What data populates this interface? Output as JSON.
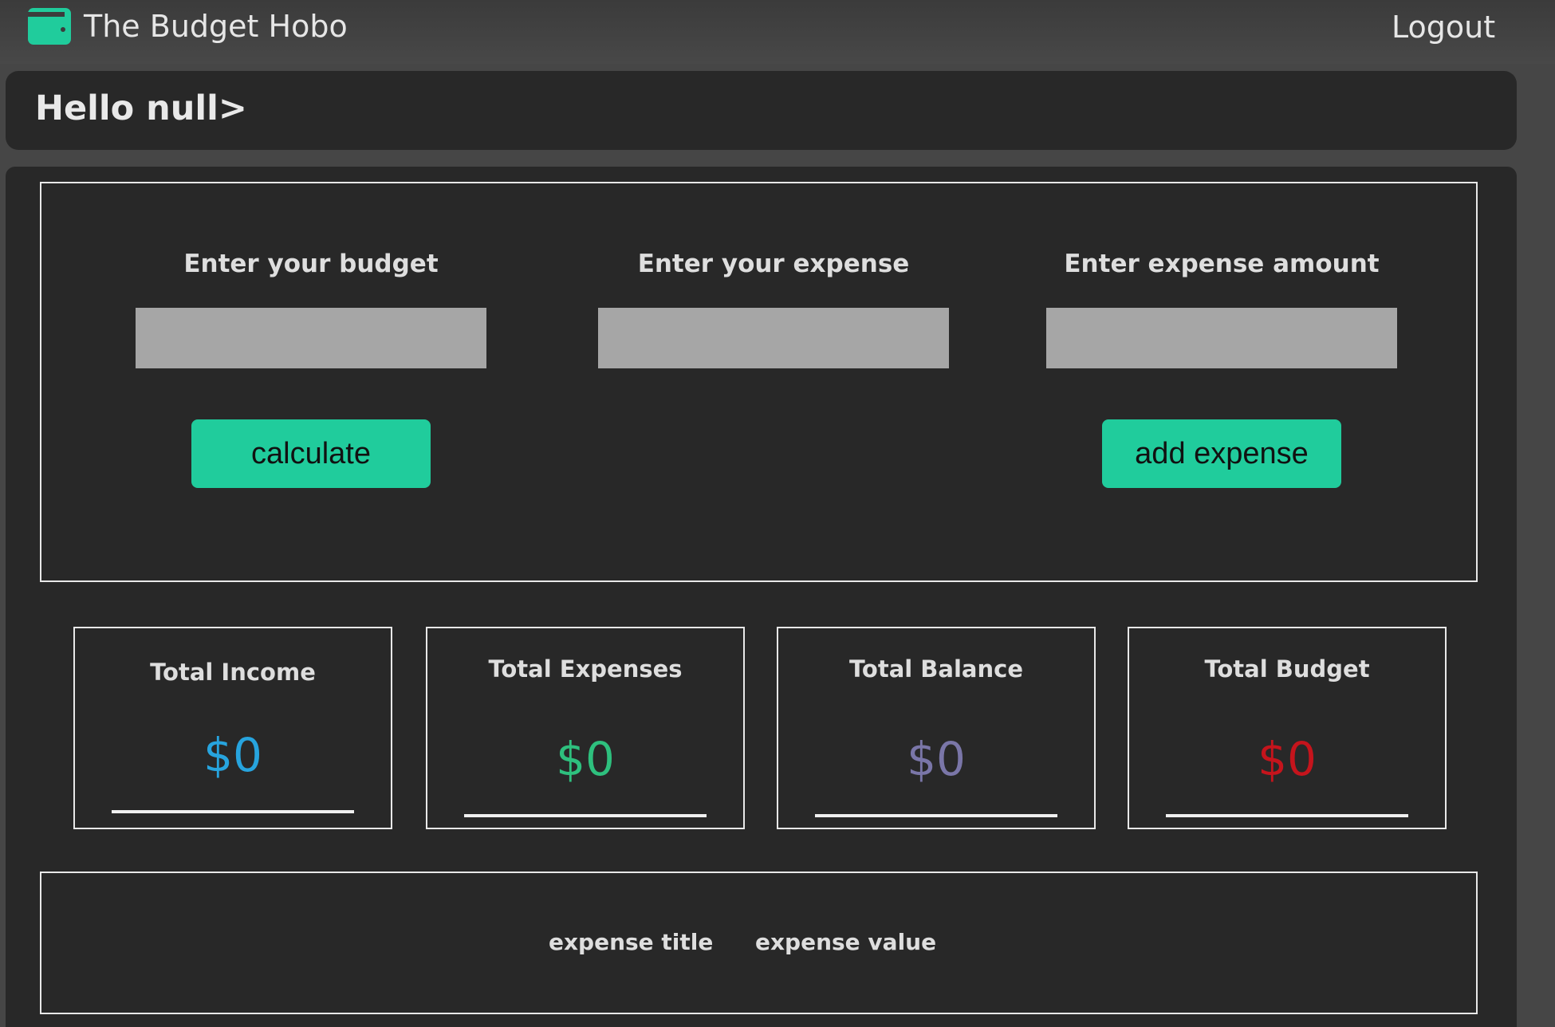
{
  "header": {
    "brand_icon": "wallet-icon",
    "title": "The Budget Hobo",
    "logout_label": "Logout"
  },
  "greeting": "Hello null>",
  "form": {
    "budget": {
      "label": "Enter your budget",
      "value": "",
      "placeholder": "",
      "button_label": "calculate"
    },
    "expense_title": {
      "label": "Enter your expense",
      "value": "",
      "placeholder": ""
    },
    "expense_amount": {
      "label": "Enter expense amount",
      "value": "",
      "placeholder": "",
      "button_label": "add expense"
    }
  },
  "totals": [
    {
      "title": "Total Income",
      "value": "$0",
      "color": "#27a4de"
    },
    {
      "title": "Total Expenses",
      "value": "$0",
      "color": "#2ec07e"
    },
    {
      "title": "Total Balance",
      "value": "$0",
      "color": "#7a76a8"
    },
    {
      "title": "Total Budget",
      "value": "$0",
      "color": "#c5141c"
    }
  ],
  "expense_list": {
    "title_header": "expense title",
    "value_header": "expense value"
  },
  "colors": {
    "accent": "#20cc9c",
    "background": "#464646",
    "panel": "#282828",
    "input": "#a6a6a6"
  }
}
